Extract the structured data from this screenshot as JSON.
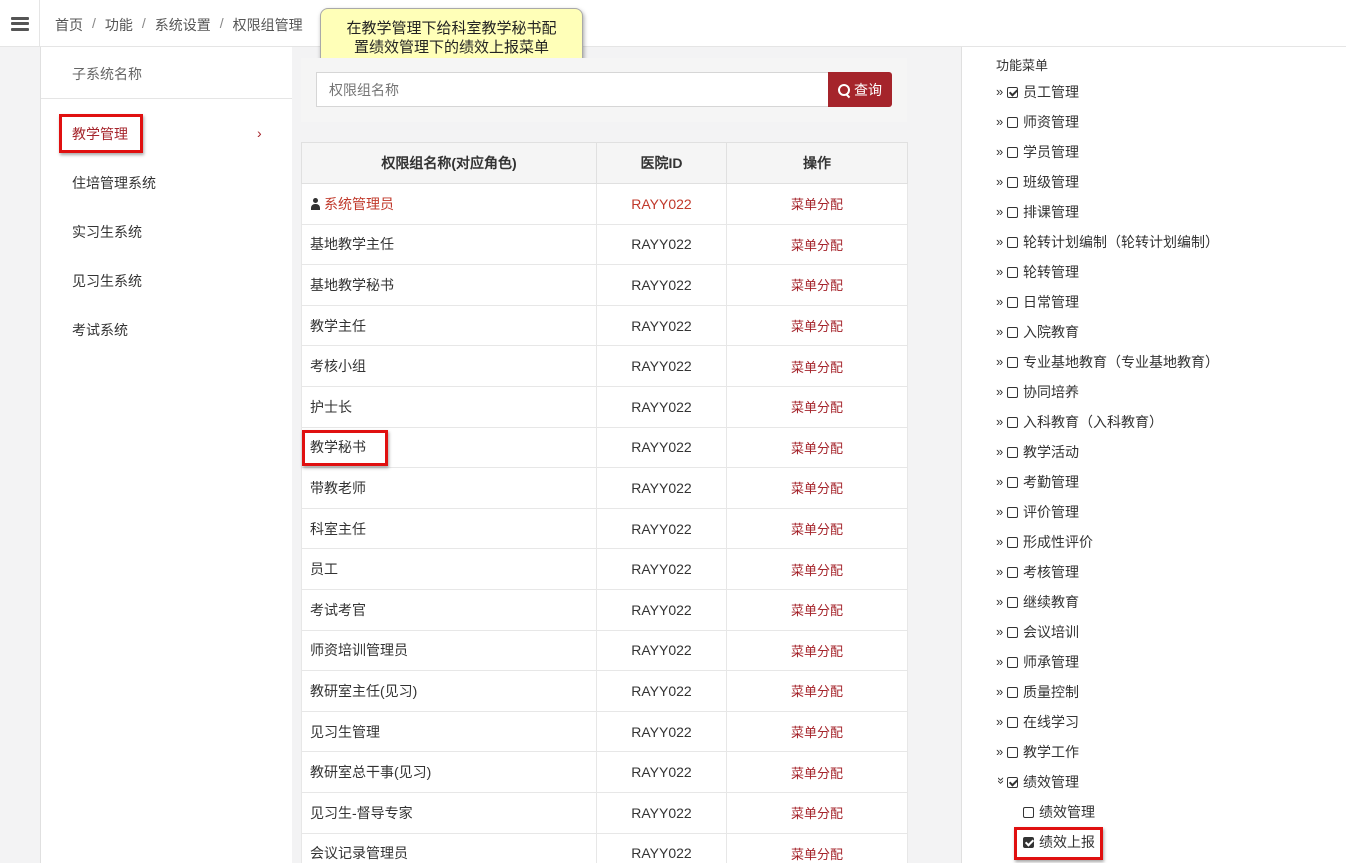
{
  "breadcrumb": [
    "首页",
    "功能",
    "系统设置",
    "权限组管理"
  ],
  "callout": {
    "line1": "在教学管理下给科室教学秘书配",
    "line2": "置绩效管理下的绩效上报菜单"
  },
  "left": {
    "title": "子系统名称",
    "items": [
      "教学管理",
      "住培管理系统",
      "实习生系统",
      "见习生系统",
      "考试系统"
    ],
    "chevron": "›"
  },
  "search": {
    "placeholder": "权限组名称",
    "button": "查询"
  },
  "table": {
    "headers": [
      "权限组名称(对应角色)",
      "医院ID",
      "操作"
    ],
    "rows": [
      {
        "name": "系统管理员",
        "id": "RAYY022",
        "op": "菜单分配"
      },
      {
        "name": "基地教学主任",
        "id": "RAYY022",
        "op": "菜单分配"
      },
      {
        "name": "基地教学秘书",
        "id": "RAYY022",
        "op": "菜单分配"
      },
      {
        "name": "教学主任",
        "id": "RAYY022",
        "op": "菜单分配"
      },
      {
        "name": "考核小组",
        "id": "RAYY022",
        "op": "菜单分配"
      },
      {
        "name": "护士长",
        "id": "RAYY022",
        "op": "菜单分配"
      },
      {
        "name": "教学秘书",
        "id": "RAYY022",
        "op": "菜单分配"
      },
      {
        "name": "带教老师",
        "id": "RAYY022",
        "op": "菜单分配"
      },
      {
        "name": "科室主任",
        "id": "RAYY022",
        "op": "菜单分配"
      },
      {
        "name": "员工",
        "id": "RAYY022",
        "op": "菜单分配"
      },
      {
        "name": "考试考官",
        "id": "RAYY022",
        "op": "菜单分配"
      },
      {
        "name": "师资培训管理员",
        "id": "RAYY022",
        "op": "菜单分配"
      },
      {
        "name": "教研室主任(见习)",
        "id": "RAYY022",
        "op": "菜单分配"
      },
      {
        "name": "见习生管理",
        "id": "RAYY022",
        "op": "菜单分配"
      },
      {
        "name": "教研室总干事(见习)",
        "id": "RAYY022",
        "op": "菜单分配"
      },
      {
        "name": "见习生-督导专家",
        "id": "RAYY022",
        "op": "菜单分配"
      },
      {
        "name": "会议记录管理员",
        "id": "RAYY022",
        "op": "菜单分配"
      }
    ]
  },
  "menu": {
    "title": "功能菜单",
    "items": [
      {
        "label": "员工管理",
        "checked": true,
        "expanded": false
      },
      {
        "label": "师资管理",
        "checked": false,
        "expanded": false
      },
      {
        "label": "学员管理",
        "checked": false,
        "expanded": false
      },
      {
        "label": "班级管理",
        "checked": false,
        "expanded": false
      },
      {
        "label": "排课管理",
        "checked": false,
        "expanded": false
      },
      {
        "label": "轮转计划编制（轮转计划编制）",
        "checked": false,
        "expanded": false
      },
      {
        "label": "轮转管理",
        "checked": false,
        "expanded": false
      },
      {
        "label": "日常管理",
        "checked": false,
        "expanded": false
      },
      {
        "label": "入院教育",
        "checked": false,
        "expanded": false
      },
      {
        "label": "专业基地教育（专业基地教育）",
        "checked": false,
        "expanded": false
      },
      {
        "label": "协同培养",
        "checked": false,
        "expanded": false
      },
      {
        "label": "入科教育（入科教育）",
        "checked": false,
        "expanded": false
      },
      {
        "label": "教学活动",
        "checked": false,
        "expanded": false
      },
      {
        "label": "考勤管理",
        "checked": false,
        "expanded": false
      },
      {
        "label": "评价管理",
        "checked": false,
        "expanded": false
      },
      {
        "label": "形成性评价",
        "checked": false,
        "expanded": false
      },
      {
        "label": "考核管理",
        "checked": false,
        "expanded": false
      },
      {
        "label": "继续教育",
        "checked": false,
        "expanded": false
      },
      {
        "label": "会议培训",
        "checked": false,
        "expanded": false
      },
      {
        "label": "师承管理",
        "checked": false,
        "expanded": false
      },
      {
        "label": "质量控制",
        "checked": false,
        "expanded": false
      },
      {
        "label": "在线学习",
        "checked": false,
        "expanded": false
      },
      {
        "label": "教学工作",
        "checked": false,
        "expanded": false
      },
      {
        "label": "绩效管理",
        "checked": true,
        "expanded": true
      }
    ],
    "children": [
      {
        "label": "绩效管理",
        "checked": false
      },
      {
        "label": "绩效上报",
        "checked": true
      }
    ],
    "collapsed_glyph": "»",
    "expanded_glyph": "»"
  },
  "colors": {
    "accent": "#a5242b",
    "highlight": "#e01010",
    "callout_bg": "#ffffb8"
  }
}
